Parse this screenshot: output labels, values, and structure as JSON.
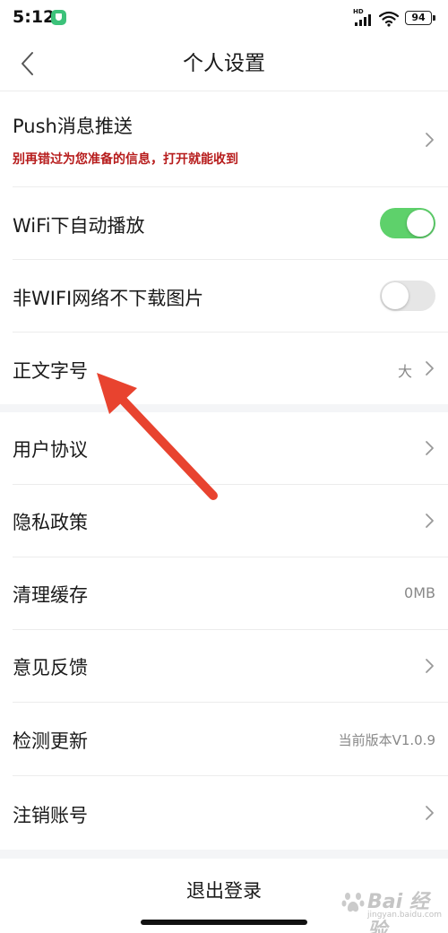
{
  "status_bar": {
    "time": "5:12",
    "network_label": "HD",
    "battery_level": "94"
  },
  "nav": {
    "title": "个人设置"
  },
  "settings": {
    "push": {
      "label": "Push消息推送",
      "subtitle": "别再错过为您准备的信息，打开就能收到"
    },
    "wifi_autoplay": {
      "label": "WiFi下自动播放",
      "enabled": true
    },
    "no_image_download": {
      "label": "非WIFI网络不下载图片",
      "enabled": false
    },
    "font_size": {
      "label": "正文字号",
      "value": "大"
    },
    "user_agreement": {
      "label": "用户协议"
    },
    "privacy_policy": {
      "label": "隐私政策"
    },
    "clear_cache": {
      "label": "清理缓存",
      "value": "0MB"
    },
    "feedback": {
      "label": "意见反馈"
    },
    "check_update": {
      "label": "检测更新",
      "value": "当前版本V1.0.9"
    },
    "cancel_account": {
      "label": "注销账号"
    }
  },
  "logout": {
    "label": "退出登录"
  },
  "watermark": {
    "brand": "Bai 经验",
    "url": "jingyan.baidu.com"
  },
  "colors": {
    "toggle_on": "#5ed16b",
    "toggle_off": "#e6e6e6",
    "subtitle_red": "#b71c1c",
    "annotation_arrow": "#e8432f",
    "section_gap": "#f4f5f7"
  }
}
